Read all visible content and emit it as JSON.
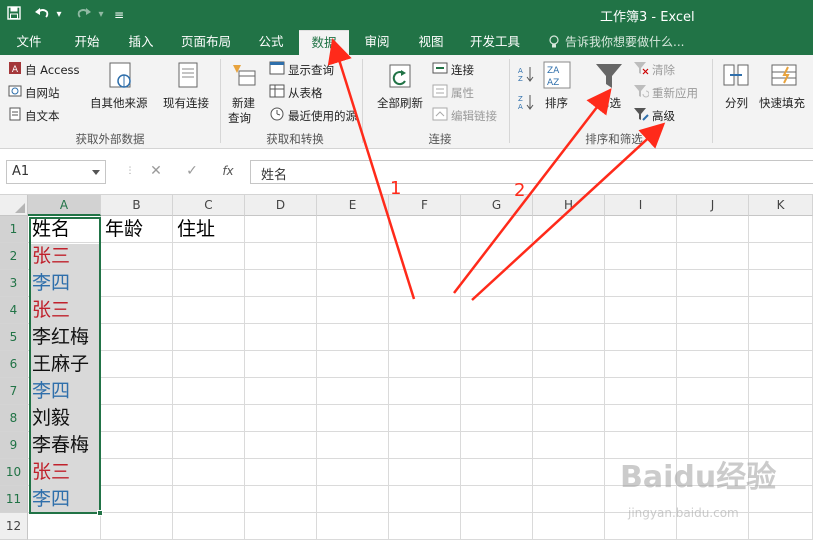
{
  "window": {
    "title": "工作簿3 - Excel"
  },
  "quick_access": {
    "save_icon": "save-icon",
    "undo_icon": "undo-icon",
    "undo_arrow": "▾",
    "redo_icon": "redo-icon",
    "redo_arrow": "▾",
    "customize_icon": "customize-icon",
    "customize_glyph": "≡"
  },
  "tabs": [
    {
      "label": "文件"
    },
    {
      "label": "开始"
    },
    {
      "label": "插入"
    },
    {
      "label": "页面布局"
    },
    {
      "label": "公式"
    },
    {
      "label": "数据"
    },
    {
      "label": "审阅"
    },
    {
      "label": "视图"
    },
    {
      "label": "开发工具"
    },
    {
      "label": "告诉我你想要做什么..."
    }
  ],
  "ribbon": {
    "get_external": {
      "from_access": "自 Access",
      "from_web": "自网站",
      "from_text": "自文本",
      "other_sources": "自其他来源",
      "existing": "现有连接",
      "label": "获取外部数据"
    },
    "get_transform": {
      "new_query": "新建",
      "new_query2": "查询",
      "show_queries": "显示查询",
      "from_table": "从表格",
      "recent": "最近使用的源",
      "label": "获取和转换"
    },
    "connections": {
      "refresh_all": "全部刷新",
      "connections": "连接",
      "properties": "属性",
      "edit_links": "编辑链接",
      "label": "连接"
    },
    "sort_filter": {
      "sort": "排序",
      "filter": "筛选",
      "clear": "清除",
      "reapply": "重新应用",
      "advanced": "高级",
      "label": "排序和筛选"
    },
    "data_tools": {
      "text_to_columns": "分列",
      "flash_fill": "快速填充"
    }
  },
  "formula_bar": {
    "name_box": "A1",
    "cancel": "✕",
    "enter": "✓",
    "fx": "fx",
    "content": "姓名"
  },
  "grid": {
    "columns": [
      "A",
      "B",
      "C",
      "D",
      "E",
      "F",
      "G",
      "H",
      "I",
      "J",
      "K"
    ],
    "rows": [
      "1",
      "2",
      "3",
      "4",
      "5",
      "6",
      "7",
      "8",
      "9",
      "10",
      "11",
      "12"
    ],
    "header": [
      "姓名",
      "年龄",
      "住址"
    ],
    "names": [
      "张三",
      "李四",
      "张三",
      "李红梅",
      "王麻子",
      "李四",
      "刘毅",
      "李春梅",
      "张三",
      "李四"
    ]
  },
  "colors": {
    "excel_green": "#217346",
    "dup_red": "#c0212c",
    "dup_blue": "#2f6fab",
    "arrow_red": "#ff2a1a"
  },
  "annotations": {
    "num1": "1",
    "num2": "2"
  },
  "watermark": {
    "brand": "Baidu经验",
    "url": "jingyan.baidu.com"
  }
}
